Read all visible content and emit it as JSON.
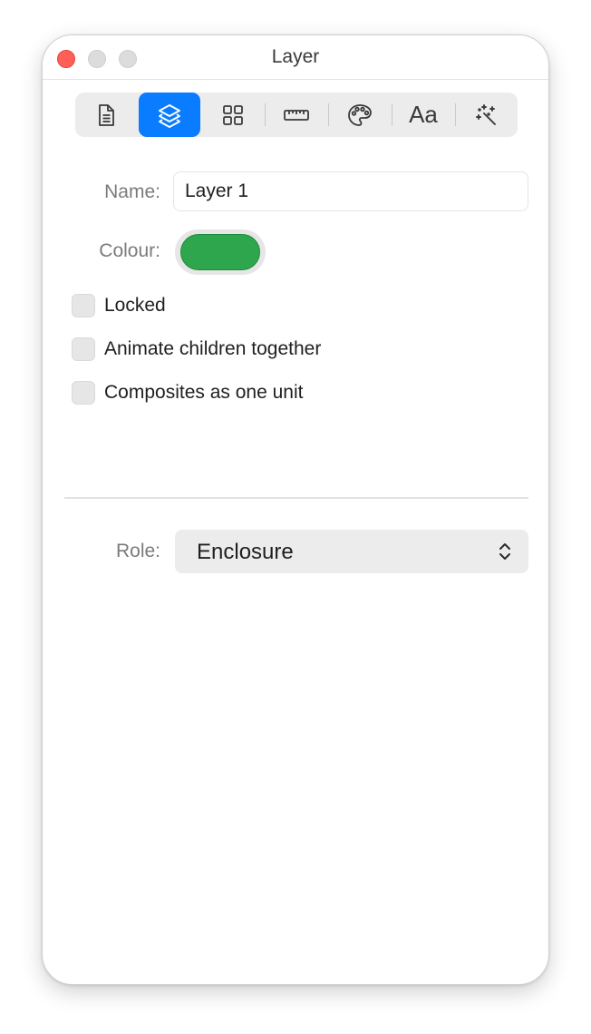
{
  "window": {
    "title": "Layer"
  },
  "toolbar": {
    "tools": [
      {
        "name": "document",
        "icon": "document-icon",
        "selected": false
      },
      {
        "name": "layer",
        "icon": "layers-icon",
        "selected": true
      },
      {
        "name": "grid",
        "icon": "grid-icon",
        "selected": false
      },
      {
        "name": "ruler",
        "icon": "ruler-icon",
        "selected": false
      },
      {
        "name": "palette",
        "icon": "palette-icon",
        "selected": false
      },
      {
        "name": "font",
        "icon": "font-icon",
        "label": "Aa",
        "selected": false
      },
      {
        "name": "effects",
        "icon": "magic-wand-icon",
        "selected": false
      }
    ]
  },
  "form": {
    "name_label": "Name:",
    "name_value": "Layer 1",
    "colour_label": "Colour:",
    "colour_value": "#2ea64e",
    "options": [
      {
        "label": "Locked",
        "checked": false
      },
      {
        "label": "Animate children together",
        "checked": false
      },
      {
        "label": "Composites as one unit",
        "checked": false
      }
    ],
    "role_label": "Role:",
    "role_value": "Enclosure"
  },
  "colors": {
    "accent": "#0a7cff",
    "close": "#ff5f57"
  }
}
